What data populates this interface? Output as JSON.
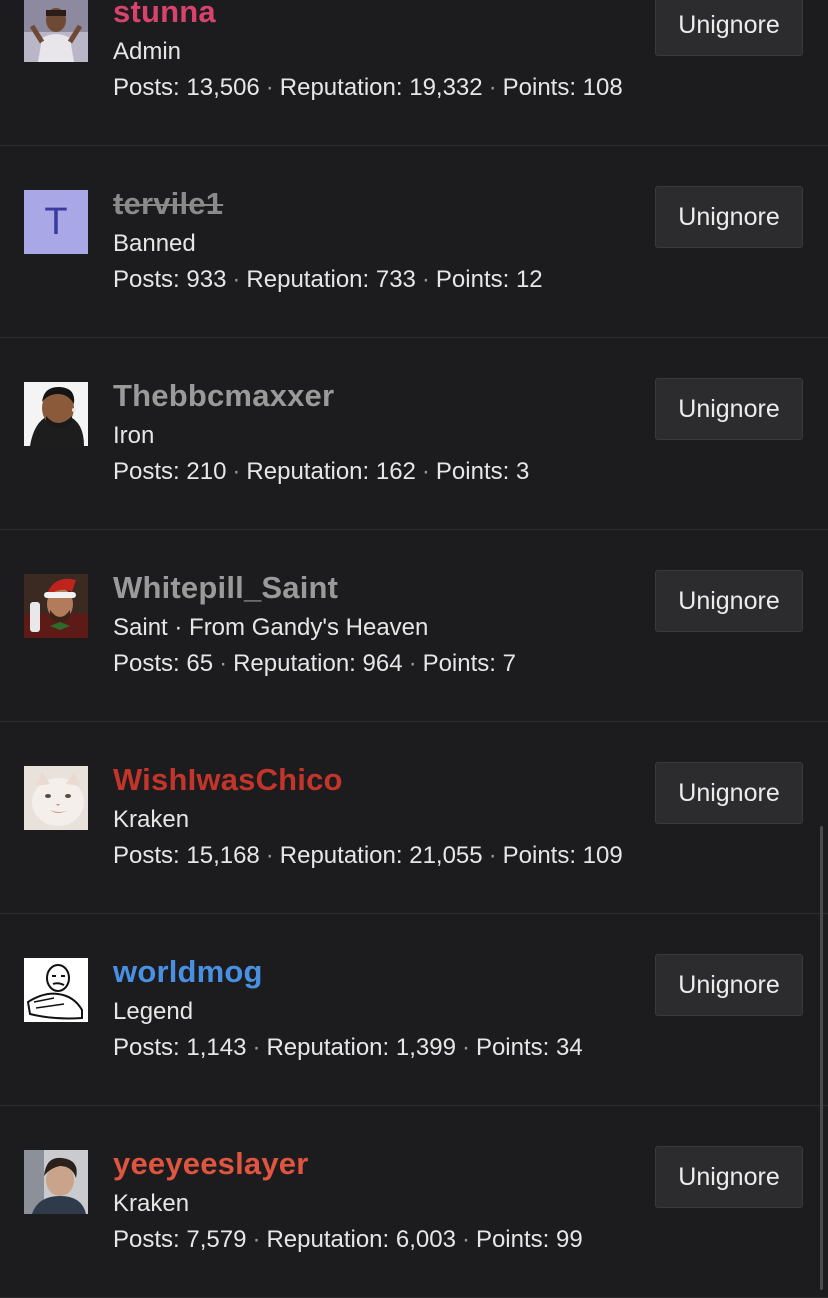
{
  "ignored_users": [
    {
      "username": "stunna",
      "username_color": "#d8436d",
      "user_title": "Admin",
      "posts_label": "Posts:",
      "posts": "13,506",
      "reputation_label": "Reputation:",
      "reputation": "19,332",
      "points_label": "Points:",
      "points": "108",
      "button_label": "Unignore",
      "avatar_icon": "photo-avatar"
    },
    {
      "username": "tervile1",
      "username_color": "#8a8a8a",
      "user_title": "Banned",
      "posts_label": "Posts:",
      "posts": "933",
      "reputation_label": "Reputation:",
      "reputation": "733",
      "points_label": "Points:",
      "points": "12",
      "button_label": "Unignore",
      "avatar_letter": "T"
    },
    {
      "username": "Thebbcmaxxer",
      "username_color": "#9a9a9a",
      "user_title": "Iron",
      "posts_label": "Posts:",
      "posts": "210",
      "reputation_label": "Reputation:",
      "reputation": "162",
      "points_label": "Points:",
      "points": "3",
      "button_label": "Unignore",
      "avatar_icon": "cartoon-avatar"
    },
    {
      "username": "Whitepill_Saint",
      "username_color": "#9a9a9a",
      "user_title": "Saint · From Gandy's Heaven",
      "posts_label": "Posts:",
      "posts": "65",
      "reputation_label": "Reputation:",
      "reputation": "964",
      "points_label": "Points:",
      "points": "7",
      "button_label": "Unignore",
      "avatar_icon": "santa-photo-avatar"
    },
    {
      "username": "WishIwasChico",
      "username_color": "#c3352a",
      "user_title": "Kraken",
      "posts_label": "Posts:",
      "posts": "15,168",
      "reputation_label": "Reputation:",
      "reputation": "21,055",
      "points_label": "Points:",
      "points": "109",
      "button_label": "Unignore",
      "avatar_icon": "cat-photo-avatar"
    },
    {
      "username": "worldmog",
      "username_color": "#4a90e2",
      "user_title": "Legend",
      "posts_label": "Posts:",
      "posts": "1,143",
      "reputation_label": "Reputation:",
      "reputation": "1,399",
      "points_label": "Points:",
      "points": "34",
      "button_label": "Unignore",
      "avatar_icon": "meme-sketch-avatar"
    },
    {
      "username": "yeeyeeslayer",
      "username_color": "#e0553f",
      "user_title": "Kraken",
      "posts_label": "Posts:",
      "posts": "7,579",
      "reputation_label": "Reputation:",
      "reputation": "6,003",
      "points_label": "Points:",
      "points": "99",
      "button_label": "Unignore",
      "avatar_icon": "photo-avatar"
    }
  ]
}
